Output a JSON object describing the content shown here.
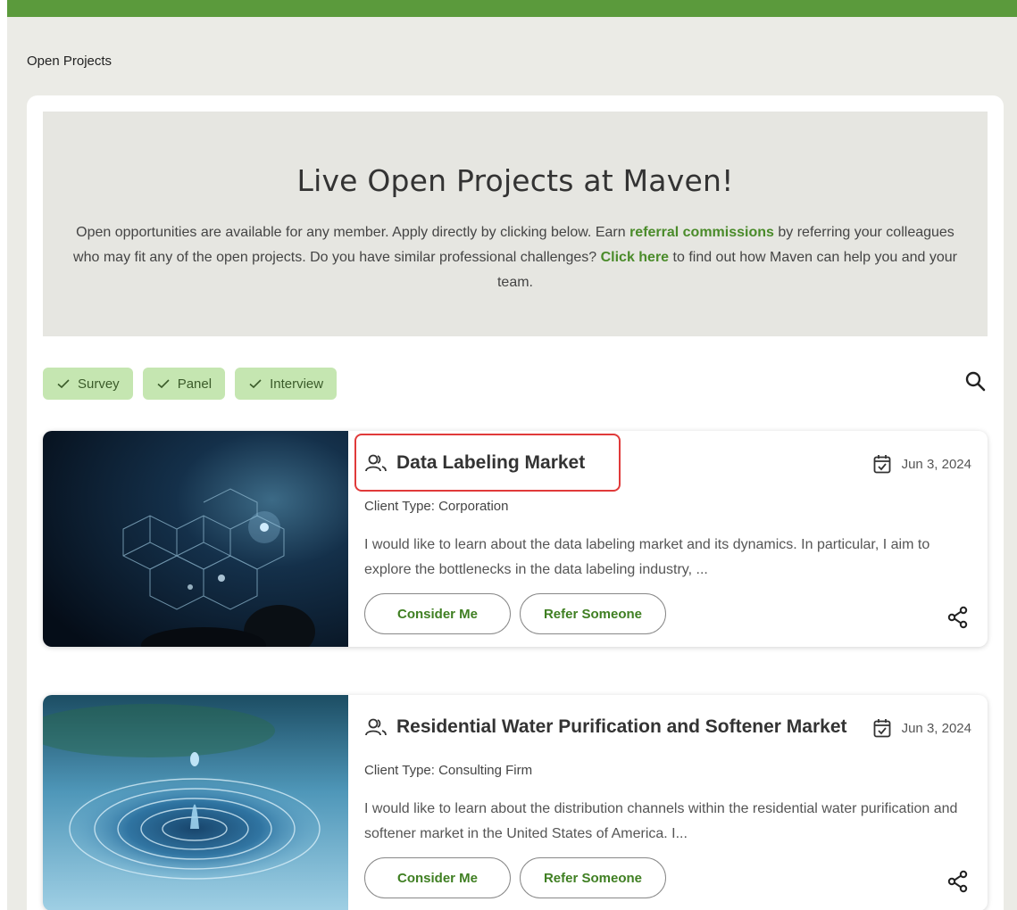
{
  "page_title": "Open Projects",
  "hero": {
    "heading": "Live Open Projects at Maven!",
    "text_before_link1": "Open opportunities are available for any member. Apply directly by clicking below. Earn ",
    "link1": "referral commissions",
    "text_between": " by referring your colleagues who may fit any of the open projects. Do you have similar professional challenges? ",
    "link2": "Click here",
    "text_after_link2": " to find out how Maven can help you and your team."
  },
  "filters": [
    {
      "label": "Survey",
      "checked": true
    },
    {
      "label": "Panel",
      "checked": true
    },
    {
      "label": "Interview",
      "checked": true
    }
  ],
  "projects": [
    {
      "title": "Data Labeling Market",
      "date": "Jun 3, 2024",
      "client_type": "Client Type: Corporation",
      "description": "I would like to learn about the data labeling market and its dynamics. In particular, I aim to explore the bottlenecks in the data labeling industry, ...",
      "consider_label": "Consider Me",
      "refer_label": "Refer Someone"
    },
    {
      "title": "Residential Water Purification and Softener Market",
      "date": "Jun 3, 2024",
      "client_type": "Client Type: Consulting Firm",
      "description": "I would like to learn about the distribution channels within the residential water purification and softener market in the United States of America. I...",
      "consider_label": "Consider Me",
      "refer_label": "Refer Someone"
    }
  ],
  "colors": {
    "accent": "#5b9a3c",
    "link": "#4a8b2a",
    "chip_bg": "#c5e6b1",
    "highlight_border": "#e03a3a"
  },
  "icons": {
    "check": "check-icon",
    "search": "search-icon",
    "people": "users-icon",
    "calendar": "calendar-check-icon",
    "share": "share-icon"
  }
}
